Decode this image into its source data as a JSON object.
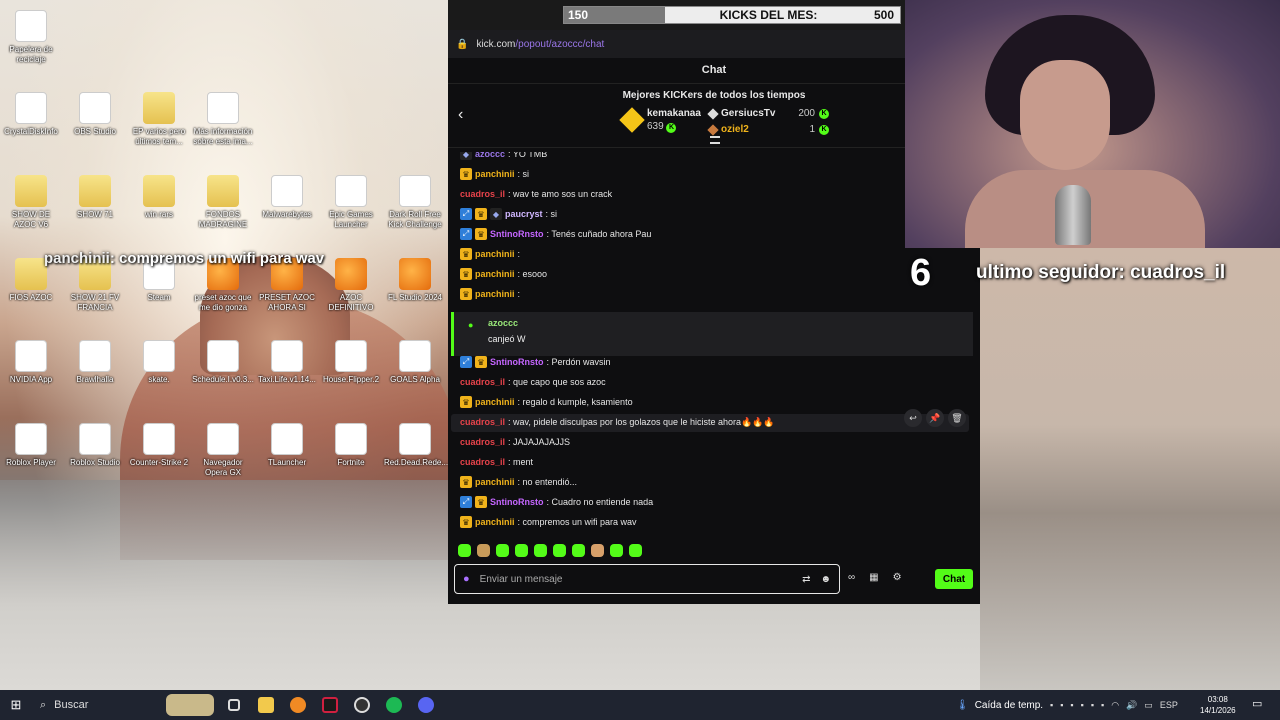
{
  "desktop": {
    "icons": [
      {
        "label": "Papelera de reciclaje"
      },
      {
        "label": "CrystalDiskInfo"
      },
      {
        "label": "OBS Studio"
      },
      {
        "label": "EP varios pero últimos tem..."
      },
      {
        "label": "Más información sobre esta ima..."
      },
      {
        "label": "SHOW DE AZOC V6"
      },
      {
        "label": "SHOW 71"
      },
      {
        "label": "win rars"
      },
      {
        "label": "FONDOS MADRAGINE"
      },
      {
        "label": "Malwarebytes"
      },
      {
        "label": "Epic Games Launcher"
      },
      {
        "label": "Dark Roll Free Kick Challenge"
      },
      {
        "label": "FIOS AZOC"
      },
      {
        "label": "SHOW 21 FV FRANCIA"
      },
      {
        "label": "Steam"
      },
      {
        "label": "preset azoc que me dio gonza"
      },
      {
        "label": "PRESET AZOC AHORA SI"
      },
      {
        "label": "AZOC DEFINITIVO"
      },
      {
        "label": "FL Studio 2024"
      },
      {
        "label": "NVIDIA App"
      },
      {
        "label": "Brawlhalla"
      },
      {
        "label": "skate."
      },
      {
        "label": "Schedule.I.v0.3..."
      },
      {
        "label": "Taxi.Life.v1.14..."
      },
      {
        "label": "House.Flipper.2"
      },
      {
        "label": "GOALS Alpha"
      },
      {
        "label": "Roblox Player"
      },
      {
        "label": "Roblox Studio"
      },
      {
        "label": "Counter-Strike 2"
      },
      {
        "label": "Navegador Opera GX"
      },
      {
        "label": "TLauncher"
      },
      {
        "label": "Fortnite"
      },
      {
        "label": "Red.Dead.Rede..."
      }
    ],
    "overlay_name": "panchinii",
    "overlay_text": ": compremos un wifi para wav"
  },
  "kicks": {
    "current": "150",
    "title": "KICKS DEL MES:",
    "goal": "500",
    "progress": 0.3
  },
  "browser": {
    "host": "kick.com",
    "path": "/popout/azoccc/chat"
  },
  "chat": {
    "header": "Chat",
    "leaderboard_title": "Mejores KICKers de todos los tiempos",
    "first": {
      "name": "kemakanaa",
      "count": "639"
    },
    "second": {
      "name": "GersiucsTv",
      "count": "200"
    },
    "third": {
      "name": "oziel2",
      "count": "1"
    },
    "messages": [
      {
        "user": "azoccc",
        "text": ": YO TMB",
        "color": "#9a76e8",
        "badges": [
          "mod"
        ]
      },
      {
        "user": "panchinii",
        "text": ": si",
        "color": "#f0b31b",
        "badges": [
          "crown"
        ]
      },
      {
        "user": "cuadros_il",
        "text": ": wav te amo sos un crack",
        "color": "#e8434b",
        "badges": []
      },
      {
        "user": "paucryst",
        "text": ": si",
        "color": "#d0b7ff",
        "badges": [
          "arrow",
          "crown",
          "mod"
        ]
      },
      {
        "user": "SntinoRnsto",
        "text": ": Tenés cuñado ahora Pau",
        "color": "#c566ff",
        "badges": [
          "arrow",
          "crown"
        ]
      },
      {
        "user": "panchinii",
        "text": ":",
        "color": "#f0b31b",
        "badges": [
          "crown"
        ]
      },
      {
        "user": "panchinii",
        "text": ": esooo",
        "color": "#f0b31b",
        "badges": [
          "crown"
        ]
      },
      {
        "user": "panchinii",
        "text": ":",
        "color": "#f0b31b",
        "badges": [
          "crown"
        ]
      },
      {
        "user": "SntinoRnsto",
        "text": ": Perdón wavsin",
        "color": "#c566ff",
        "badges": [
          "arrow",
          "crown"
        ]
      },
      {
        "user": "cuadros_il",
        "text": ": que capo que sos azoc",
        "color": "#e8434b",
        "badges": []
      },
      {
        "user": "panchinii",
        "text": ": regalo d kumple, ksamiento",
        "color": "#f0b31b",
        "badges": [
          "crown"
        ]
      },
      {
        "user": "cuadros_il",
        "text": ": wav, pidele disculpas por los golazos que le hiciste ahora🔥🔥🔥",
        "color": "#e8434b",
        "badges": []
      },
      {
        "user": "cuadros_il",
        "text": ": JAJAJAJAJJS",
        "color": "#e8434b",
        "badges": []
      },
      {
        "user": "cuadros_il",
        "text": ": ment",
        "color": "#e8434b",
        "badges": []
      },
      {
        "user": "panchinii",
        "text": ": no entendió...",
        "color": "#f0b31b",
        "badges": [
          "crown"
        ]
      },
      {
        "user": "SntinoRnsto",
        "text": ": Cuadro no entiende nada",
        "color": "#c566ff",
        "badges": [
          "arrow",
          "crown"
        ]
      },
      {
        "user": "panchinii",
        "text": ": compremos un wifi para wav",
        "color": "#f0b31b",
        "badges": [
          "crown"
        ]
      }
    ],
    "highlight": {
      "user": "azoccc",
      "text": "canjeó W"
    },
    "input_placeholder": "Enviar un mensaje",
    "send_label": "Chat"
  },
  "stream_overlay": {
    "count": "6",
    "follower_text": "ultimo seguidor: cuadros_il"
  },
  "taskbar": {
    "search_label": "Buscar",
    "weather": "Caída de temp.",
    "lang": "ESP",
    "time": "03:08",
    "date": "14/1/2026"
  }
}
